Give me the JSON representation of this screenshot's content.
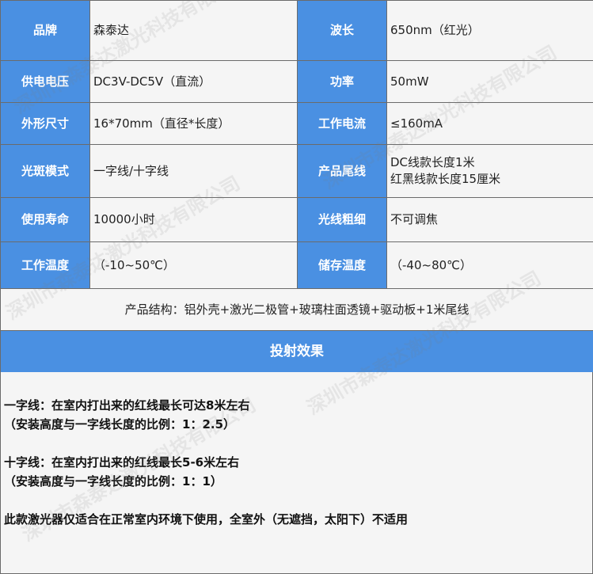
{
  "specs": {
    "rows": [
      {
        "l1": "品牌",
        "v1": "森泰达",
        "l2": "波长",
        "v2a": "650nm（红光）",
        "v2b": ""
      },
      {
        "l1": "供电电压",
        "v1": "DC3V-DC5V（直流）",
        "l2": "功率",
        "v2a": "50mW",
        "v2b": ""
      },
      {
        "l1": "外形尺寸",
        "v1": "16*70mm（直径*长度）",
        "l2": "工作电流",
        "v2a": "≤160mA",
        "v2b": ""
      },
      {
        "l1": "光斑模式",
        "v1": "一字线/十字线",
        "l2": "产品尾线",
        "v2a": "DC线款长度1米",
        "v2b": "红黑线款长度15厘米"
      },
      {
        "l1": "使用寿命",
        "v1": "10000小时",
        "l2": "光线粗细",
        "v2a": "不可调焦",
        "v2b": ""
      },
      {
        "l1": "工作温度",
        "v1": "（-10~50℃）",
        "l2": "储存温度",
        "v2a": "（-40~80℃）",
        "v2b": ""
      }
    ],
    "structure": "产品结构：铝外壳+激光二极管+玻璃柱面透镜+驱动板+1米尾线"
  },
  "effect": {
    "title": "投射效果",
    "line1": "一字线：在室内打出来的红线最长可达8米左右",
    "line1_ratio": "（安装高度与一字线长度的比例：1：2.5）",
    "line2": "十字线：在室内打出来的红线最长5-6米左右",
    "line2_ratio": "（安装高度与一字线长度的比例：1：1）",
    "note": "此款激光器仅适合在正常室内环境下使用，全室外（无遮挡，太阳下）不适用"
  },
  "watermark": "深圳市森泰达激光科技有限公司",
  "colors": {
    "header_blue": "#4a90e2",
    "cell_bg": "#f5f5f5",
    "border": "#6b6b6b"
  }
}
